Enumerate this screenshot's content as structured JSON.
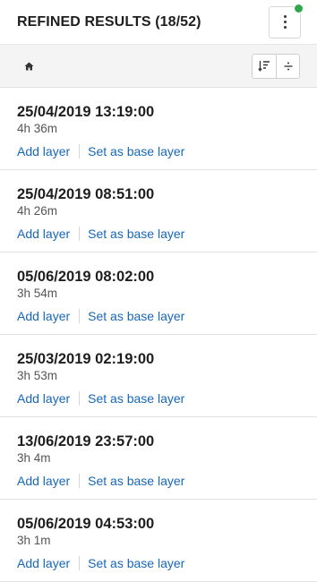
{
  "header": {
    "title": "REFINED RESULTS (18/52)",
    "menu_icon": "kebab-menu-icon",
    "status_color": "#2ea84b"
  },
  "toolbar": {
    "home_icon": "home-icon",
    "sort_icon": "sort-icon",
    "filter_icon": "divide-icon"
  },
  "results": [
    {
      "date": "25/04/2019 13:19:00",
      "duration": "4h 36m",
      "add_label": "Add layer",
      "base_label": "Set as base layer"
    },
    {
      "date": "25/04/2019 08:51:00",
      "duration": "4h 26m",
      "add_label": "Add layer",
      "base_label": "Set as base layer"
    },
    {
      "date": "05/06/2019 08:02:00",
      "duration": "3h 54m",
      "add_label": "Add layer",
      "base_label": "Set as base layer"
    },
    {
      "date": "25/03/2019 02:19:00",
      "duration": "3h 53m",
      "add_label": "Add layer",
      "base_label": "Set as base layer"
    },
    {
      "date": "13/06/2019 23:57:00",
      "duration": "3h 4m",
      "add_label": "Add layer",
      "base_label": "Set as base layer"
    },
    {
      "date": "05/06/2019 04:53:00",
      "duration": "3h 1m",
      "add_label": "Add layer",
      "base_label": "Set as base layer"
    }
  ],
  "colors": {
    "link": "#1767b8",
    "toolbar_bg": "#f4f4f4"
  }
}
